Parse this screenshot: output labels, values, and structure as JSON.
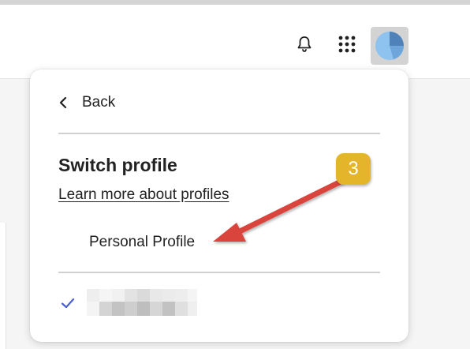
{
  "popover": {
    "back_label": "Back",
    "section_title": "Switch profile",
    "learn_more_link": "Learn more about profiles",
    "profiles": [
      {
        "label": "Personal Profile"
      }
    ]
  },
  "annotation": {
    "step_number": "3",
    "badge_color": "#e4b52a",
    "arrow_color": "#d9453e"
  },
  "icons": {
    "notifications": "bell-icon",
    "apps": "app-grid-icon",
    "avatar": "user-avatar-icon",
    "back": "chevron-left-icon",
    "current_profile": "checkmark-icon"
  },
  "colors": {
    "checkmark": "#4a5fd1",
    "avatar_fill": "#8ec3f0",
    "avatar_bg": "#d3d3d3"
  }
}
